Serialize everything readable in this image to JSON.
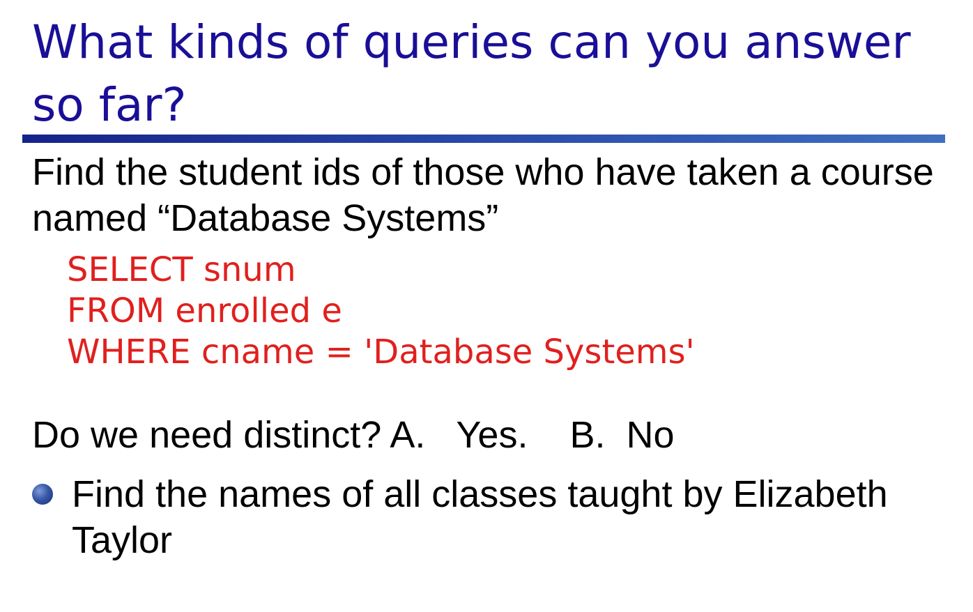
{
  "slide": {
    "title": "What kinds of queries can you answer so far?",
    "question": "Find the student ids of those who have taken a course named “Database Systems”",
    "sql": {
      "line1": "SELECT snum",
      "line2": "FROM enrolled e",
      "line3": "WHERE cname = 'Database Systems'"
    },
    "distinct_question": "Do we need distinct? A.   Yes.    B.  No",
    "bullet_item": "Find the names of all classes taught by Elizabeth Taylor"
  },
  "colors": {
    "title": "#1a0f96",
    "sql": "#e0201e",
    "rule": "#2a4aa8",
    "body_text": "#000000"
  },
  "icons": {
    "bullet": "bullet-dot-icon"
  }
}
